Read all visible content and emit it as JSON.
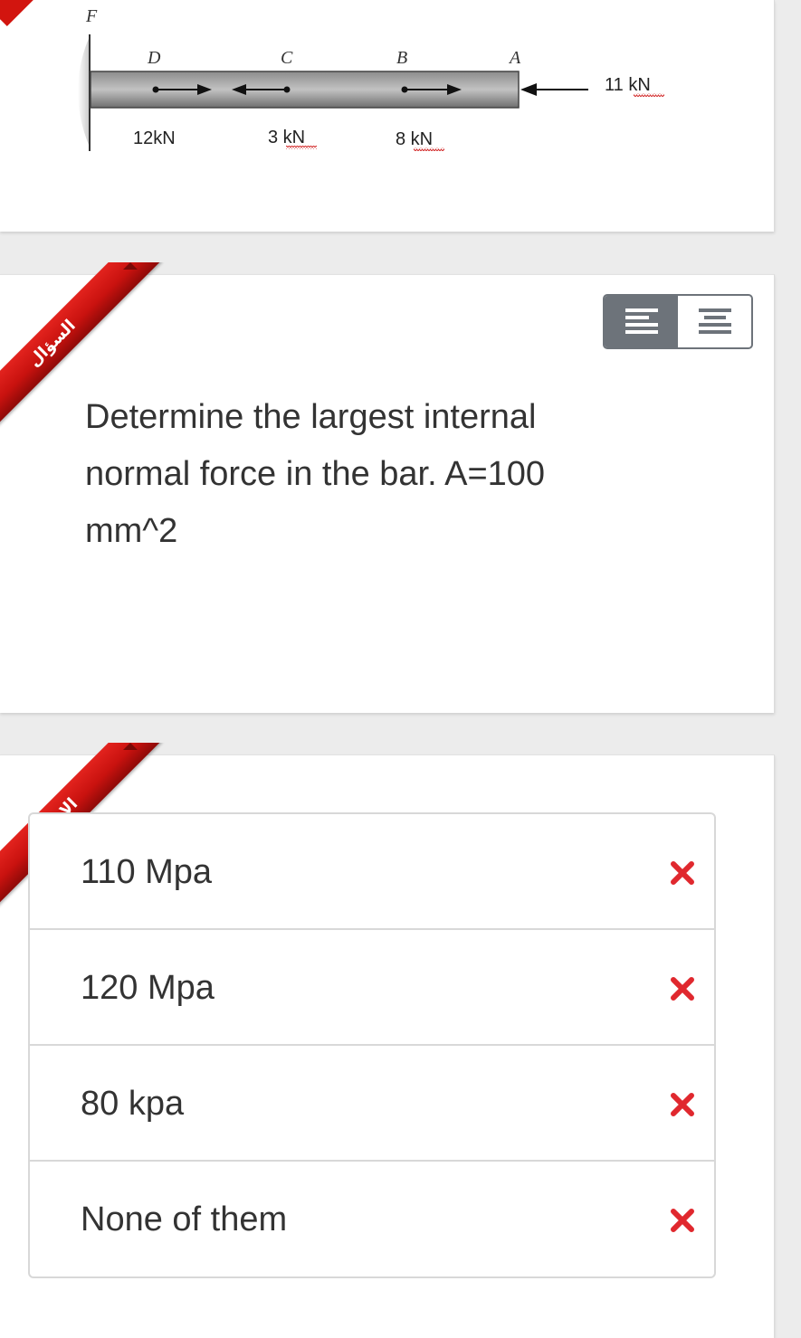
{
  "diagram": {
    "points": {
      "F": "F",
      "D": "D",
      "C": "C",
      "B": "B",
      "A": "A"
    },
    "loads": {
      "d": "12kN",
      "c": "3 kN",
      "b": "8 kN",
      "a": "11 kN"
    }
  },
  "question": {
    "ribbon_label": "السؤال",
    "text": "Determine the largest internal normal force in the bar. A=100 mm^2"
  },
  "answers": {
    "ribbon_label": "الاجابات",
    "options": [
      {
        "label": "110 Mpa",
        "status": "incorrect"
      },
      {
        "label": "120 Mpa",
        "status": "incorrect"
      },
      {
        "label": "80 kpa",
        "status": "incorrect"
      },
      {
        "label": "None of them",
        "status": "incorrect"
      }
    ]
  },
  "colors": {
    "ribbon": "#d2150f",
    "incorrect_mark": "#e0282e",
    "toggle": "#6d737a"
  },
  "icons": {
    "align_left": "align-left-icon",
    "align_center": "align-center-icon",
    "incorrect": "close-icon"
  }
}
